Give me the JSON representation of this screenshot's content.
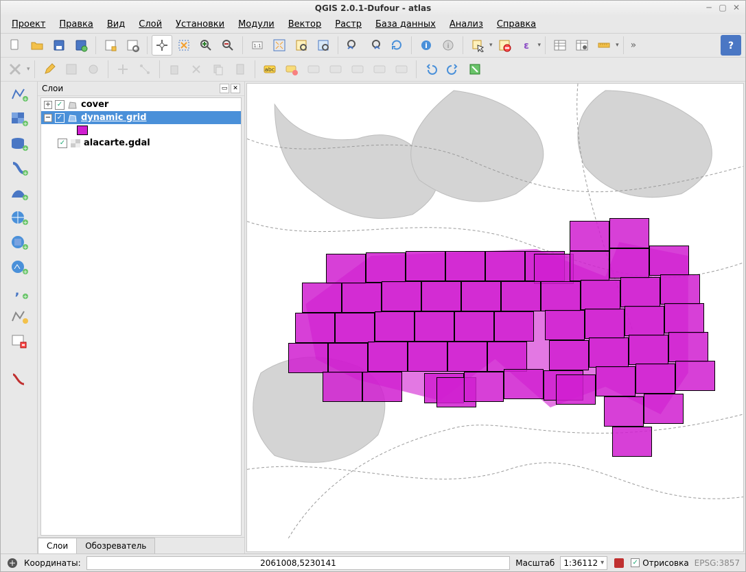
{
  "window": {
    "title": "QGIS 2.0.1-Dufour - atlas"
  },
  "menu": {
    "project": "Проект",
    "edit": "Правка",
    "view": "Вид",
    "layer": "Слой",
    "settings": "Установки",
    "plugins": "Модули",
    "vector": "Вектор",
    "raster": "Растр",
    "database": "База данных",
    "analysis": "Анализ",
    "help": "Справка"
  },
  "layers_panel": {
    "title": "Слои",
    "tabs": {
      "layers": "Слои",
      "browser": "Обозреватель"
    },
    "items": [
      {
        "label": "cover"
      },
      {
        "label": "dynamic grid"
      },
      {
        "label": "alacarte.gdal"
      }
    ]
  },
  "status": {
    "coords_label": "Координаты:",
    "coords_value": "2061008,5230141",
    "scale_label": "Масштаб",
    "scale_value": "1:36112",
    "render_label": "Отрисовка",
    "crs": "EPSG:3857"
  },
  "colors": {
    "grid_fill": "#d01ed0"
  }
}
